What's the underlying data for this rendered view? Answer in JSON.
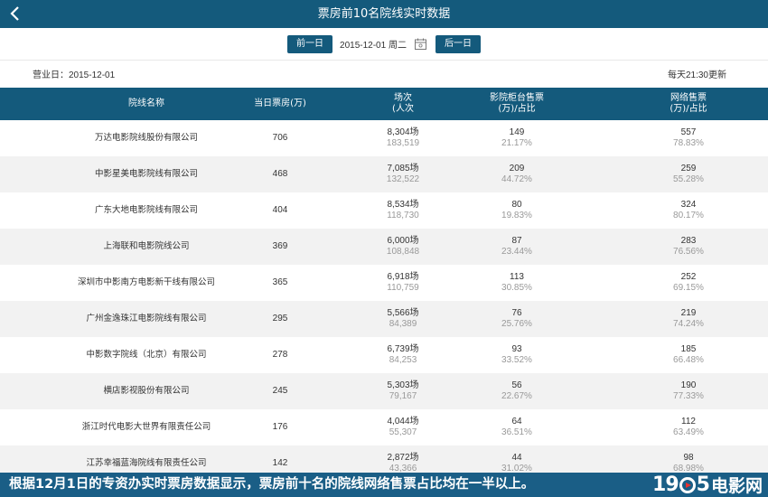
{
  "header": {
    "title": "票房前10名院线实时数据",
    "back_icon": "chevron-left-icon"
  },
  "datebar": {
    "prev_label": "前一日",
    "date": "2015-12-01 周二",
    "next_label": "后一日",
    "calendar_icon": "calendar-icon"
  },
  "info": {
    "business_day": "营业日：2015-12-01",
    "update_note": "每天21:30更新"
  },
  "table": {
    "headers": {
      "name": "院线名称",
      "box": "当日票房(万)",
      "sessions_1": "场次",
      "sessions_2": "(人次",
      "counter_1": "影院柜台售票",
      "counter_2": "(万)/占比",
      "online_1": "网络售票",
      "online_2": "(万)/占比"
    },
    "rows": [
      {
        "name": "万达电影院线股份有限公司",
        "box": "706",
        "sessions": "8,304场",
        "admissions": "183,519",
        "counter": "149",
        "counter_pct": "21.17%",
        "online": "557",
        "online_pct": "78.83%"
      },
      {
        "name": "中影星美电影院线有限公司",
        "box": "468",
        "sessions": "7,085场",
        "admissions": "132,522",
        "counter": "209",
        "counter_pct": "44.72%",
        "online": "259",
        "online_pct": "55.28%"
      },
      {
        "name": "广东大地电影院线有限公司",
        "box": "404",
        "sessions": "8,534场",
        "admissions": "118,730",
        "counter": "80",
        "counter_pct": "19.83%",
        "online": "324",
        "online_pct": "80.17%"
      },
      {
        "name": "上海联和电影院线公司",
        "box": "369",
        "sessions": "6,000场",
        "admissions": "108,848",
        "counter": "87",
        "counter_pct": "23.44%",
        "online": "283",
        "online_pct": "76.56%"
      },
      {
        "name": "深圳市中影南方电影新干线有限公司",
        "box": "365",
        "sessions": "6,918场",
        "admissions": "110,759",
        "counter": "113",
        "counter_pct": "30.85%",
        "online": "252",
        "online_pct": "69.15%"
      },
      {
        "name": "广州金逸珠江电影院线有限公司",
        "box": "295",
        "sessions": "5,566场",
        "admissions": "84,389",
        "counter": "76",
        "counter_pct": "25.76%",
        "online": "219",
        "online_pct": "74.24%"
      },
      {
        "name": "中影数字院线（北京）有限公司",
        "box": "278",
        "sessions": "6,739场",
        "admissions": "84,253",
        "counter": "93",
        "counter_pct": "33.52%",
        "online": "185",
        "online_pct": "66.48%"
      },
      {
        "name": "横店影视股份有限公司",
        "box": "245",
        "sessions": "5,303场",
        "admissions": "79,167",
        "counter": "56",
        "counter_pct": "22.67%",
        "online": "190",
        "online_pct": "77.33%"
      },
      {
        "name": "浙江时代电影大世界有限责任公司",
        "box": "176",
        "sessions": "4,044场",
        "admissions": "55,307",
        "counter": "64",
        "counter_pct": "36.51%",
        "online": "112",
        "online_pct": "63.49%"
      },
      {
        "name": "江苏幸福蓝海院线有限责任公司",
        "box": "142",
        "sessions": "2,872场",
        "admissions": "43,366",
        "counter": "44",
        "counter_pct": "31.02%",
        "online": "98",
        "online_pct": "68.98%"
      }
    ]
  },
  "caption": {
    "text": "根据12月1日的专资办实时票房数据显示，票房前十名的院线网络售票占比均在一半以上。",
    "logo_num_1": "19",
    "logo_num_2": "5",
    "logo_cn": "电影网"
  },
  "colors": {
    "header_bg": "#145a7c",
    "caption_bg": "#1a5e86",
    "row_alt": "#f2f2f2",
    "sub_text": "#999999"
  }
}
